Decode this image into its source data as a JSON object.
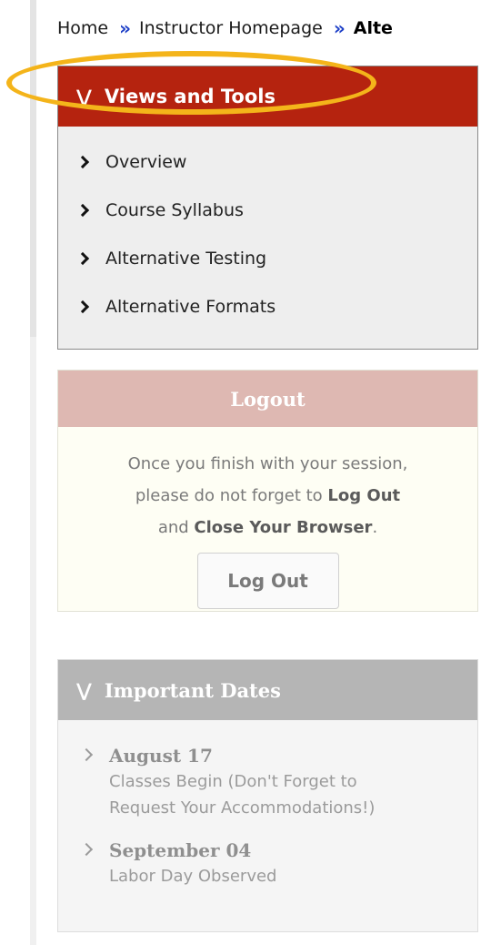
{
  "breadcrumb": {
    "items": [
      "Home",
      "Instructor Homepage"
    ],
    "current": "Alte",
    "separator": "»"
  },
  "views_tools": {
    "title": "Views and Tools",
    "collapse_glyph": "¥",
    "items": [
      {
        "label": "Overview"
      },
      {
        "label": "Course Syllabus"
      },
      {
        "label": "Alternative Testing"
      },
      {
        "label": "Alternative Formats"
      }
    ]
  },
  "logout": {
    "title": "Logout",
    "text_1": "Once you finish with your session,",
    "text_2a": "please do not forget to ",
    "text_2b": "Log Out",
    "text_3a": "and ",
    "text_3b": "Close Your Browser",
    "text_3c": ".",
    "button_label": "Log Out"
  },
  "important_dates": {
    "title": "Important Dates",
    "collapse_glyph": "¥",
    "items": [
      {
        "date": "August 17",
        "desc_1": "Classes Begin (Don't Forget to",
        "desc_2": "Request Your Accommodations!)"
      },
      {
        "date": "September 04",
        "desc_1": "Labor Day Observed"
      }
    ]
  },
  "colors": {
    "views_header": "#b5230f",
    "logout_header": "#deb8b2",
    "dates_header": "#b5b5b5",
    "highlight_ring": "#f4b41a",
    "breadcrumb_separator": "#1d3fc7"
  }
}
